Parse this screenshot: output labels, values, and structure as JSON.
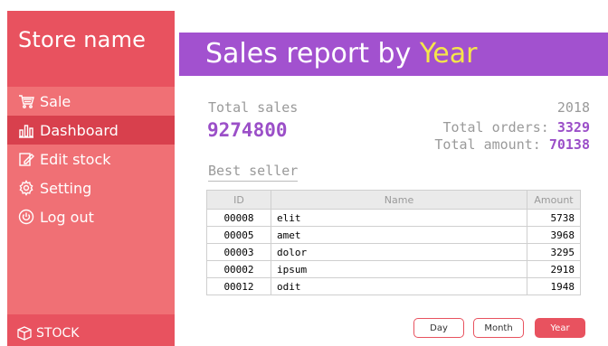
{
  "sidebar": {
    "store_name": "Store name",
    "items": [
      {
        "label": "Sale",
        "icon": "cart-icon"
      },
      {
        "label": "Dashboard",
        "icon": "chart-icon"
      },
      {
        "label": "Edit stock",
        "icon": "edit-icon"
      },
      {
        "label": "Setting",
        "icon": "gear-icon"
      },
      {
        "label": "Log out",
        "icon": "power-icon"
      }
    ],
    "footer": "STOCK"
  },
  "header": {
    "title_prefix": "Sales report by ",
    "title_highlight": "Year"
  },
  "summary": {
    "total_sales_label": "Total sales",
    "total_sales_value": "9274800",
    "year": "2018",
    "orders_label": "Total orders:",
    "orders_value": "3329",
    "amount_label": "Total amount:",
    "amount_value": "70138"
  },
  "best_seller": {
    "title": "Best seller",
    "columns": [
      "ID",
      "Name",
      "Amount"
    ],
    "rows": [
      [
        "00008",
        "elit",
        "5738"
      ],
      [
        "00005",
        "amet",
        "3968"
      ],
      [
        "00003",
        "dolor",
        "3295"
      ],
      [
        "00002",
        "ipsum",
        "2918"
      ],
      [
        "00012",
        "odit",
        "1948"
      ]
    ]
  },
  "period_buttons": {
    "day": "Day",
    "month": "Month",
    "year": "Year"
  },
  "colors": {
    "sidebar": "#e8525f",
    "header": "#a251cf",
    "highlight": "#f5e64a",
    "value": "#9b4fc8"
  }
}
